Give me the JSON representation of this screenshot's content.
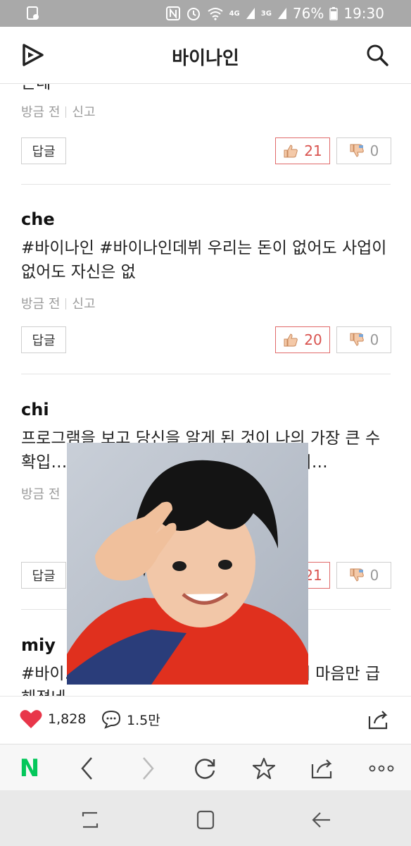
{
  "status_bar": {
    "battery": "76%",
    "time": "19:30",
    "network_badge_1": "4G",
    "network_badge_2": "3G"
  },
  "header": {
    "title": "바이나인"
  },
  "comments": [
    {
      "author": "",
      "text_partial": "는데",
      "time": "방금 전",
      "report": "신고",
      "reply": "답글",
      "likes": "21",
      "dislikes": "0"
    },
    {
      "author": "che",
      "text": "#바이나인 #바이나인데뷔 우리는 돈이 없어도 사업이 없어도 자신은 없",
      "time": "방금 전",
      "report": "신고",
      "reply": "답글",
      "likes": "20",
      "dislikes": "0"
    },
    {
      "author": "chi",
      "text": "프로그램을 보고 당신을 알게 된 것이 나의 가장 큰 수확입… 모두 다 경탄할 거… 을 했어 #바이…",
      "time": "방금 전",
      "report": "",
      "reply": "답글",
      "likes": "21",
      "dislikes": "0"
    },
    {
      "author": "miy",
      "text": "#바이… 들 많이 볼 수 없으니까 갈수록 내 마음만 급해졌네",
      "time": "",
      "report": "",
      "reply": "",
      "likes": "",
      "dislikes": ""
    }
  ],
  "action_bar": {
    "like_count": "1,828",
    "comment_count": "1.5만"
  },
  "browser_toolbar": {
    "home_label": "N"
  },
  "colors": {
    "accent_red": "#d9534f",
    "naver_green": "#03c75a",
    "status_bar": "#a9a9a9"
  }
}
